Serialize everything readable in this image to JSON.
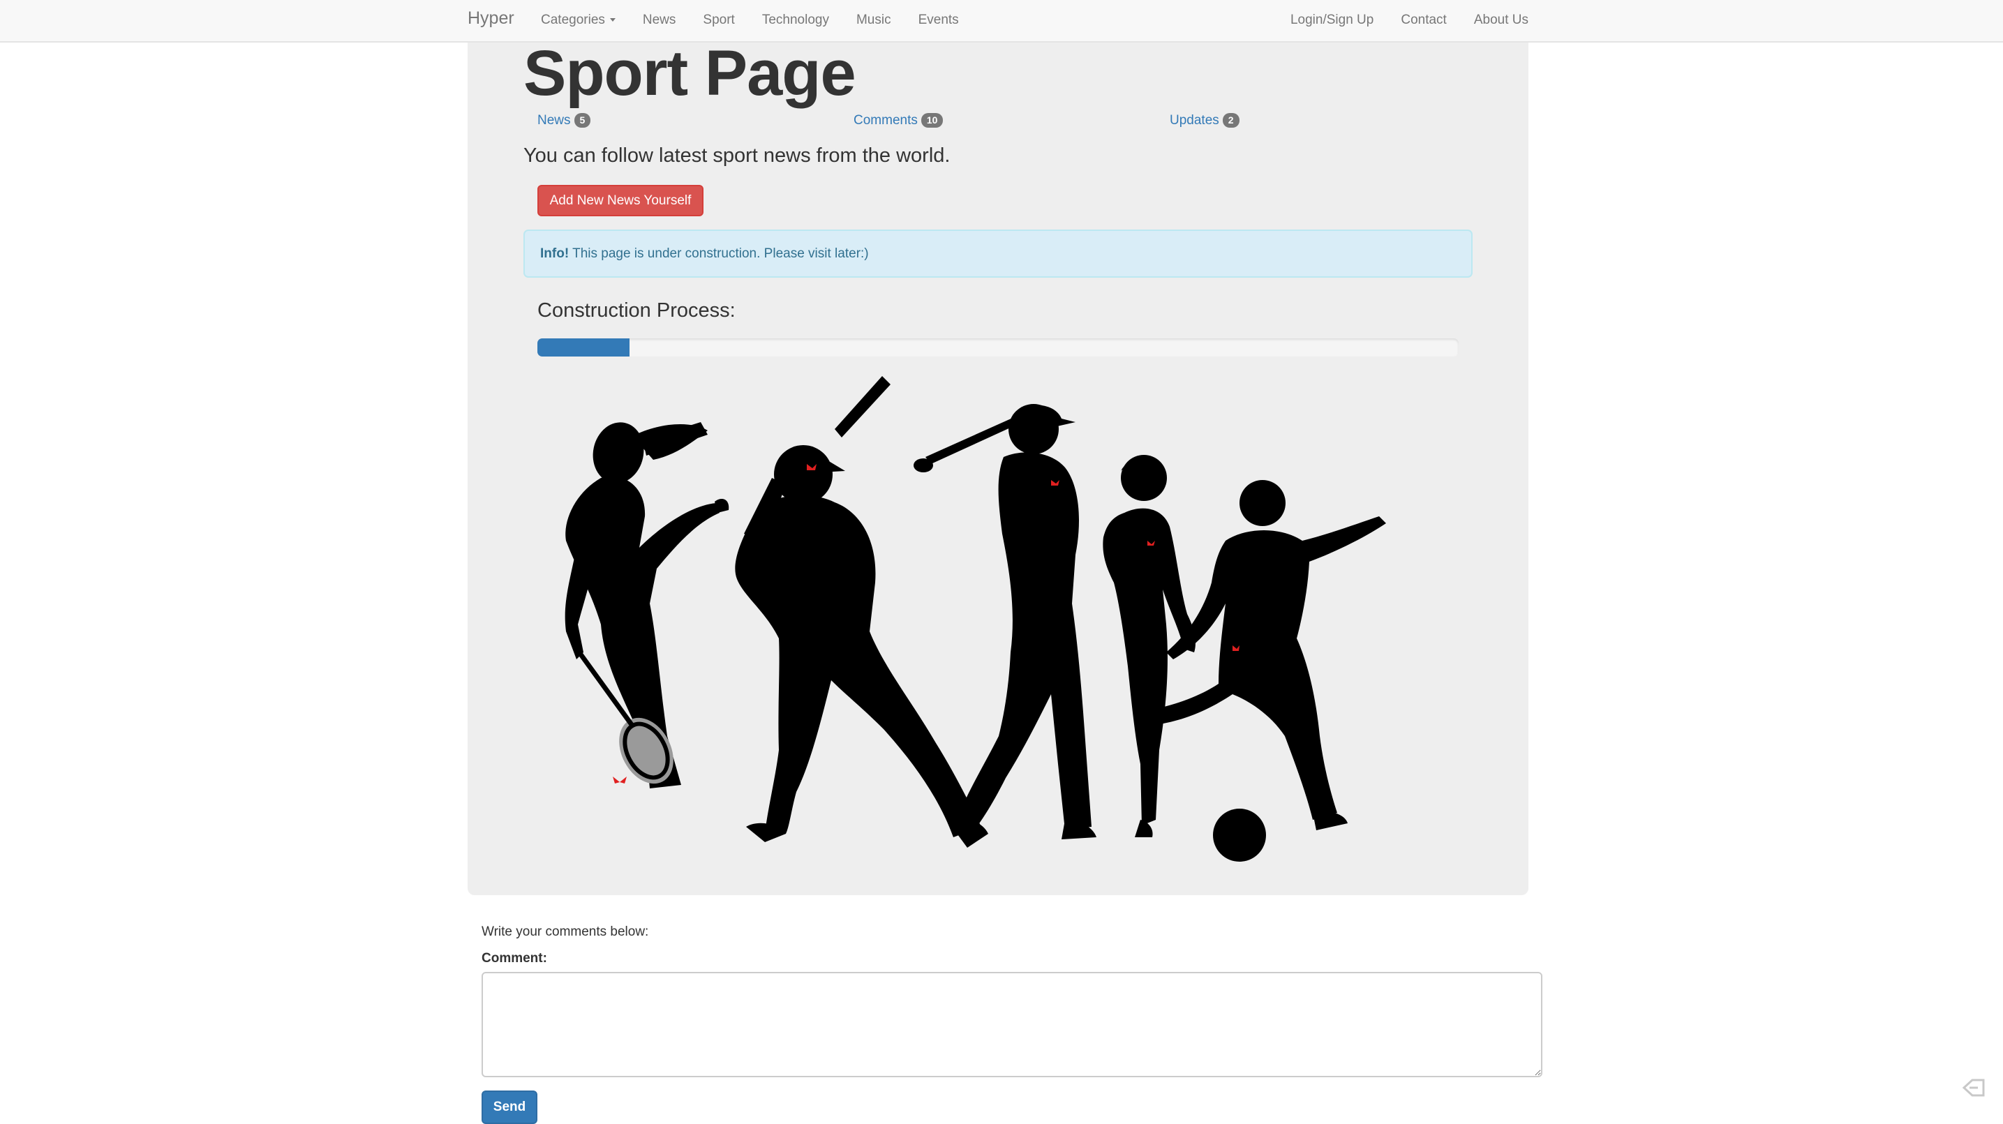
{
  "navbar": {
    "brand": "Hyper",
    "left_items": [
      {
        "label": "Categories",
        "has_dropdown": true
      },
      {
        "label": "News"
      },
      {
        "label": "Sport"
      },
      {
        "label": "Technology"
      },
      {
        "label": "Music"
      },
      {
        "label": "Events"
      }
    ],
    "right_items": [
      {
        "label": "Login/Sign Up"
      },
      {
        "label": "Contact"
      },
      {
        "label": "About Us"
      }
    ]
  },
  "main": {
    "title": "Sport Page",
    "pills": [
      {
        "label": "News",
        "count": "5"
      },
      {
        "label": "Comments",
        "count": "10"
      },
      {
        "label": "Updates",
        "count": "2"
      }
    ],
    "lead": "You can follow latest sport news from the world.",
    "add_button_label": "Add New News Yourself",
    "alert": {
      "strong": "Info!",
      "text": " This page is under construction. Please visit later:)"
    },
    "progress_label": "Construction Process:",
    "progress_percent": 10,
    "illustration": "sports-silhouettes-icon"
  },
  "comments": {
    "hint": "Write your comments below:",
    "label": "Comment:",
    "textarea_value": "",
    "send_label": "Send"
  },
  "colors": {
    "navbar_bg": "#f8f8f8",
    "link": "#337ab7",
    "danger": "#d9534f",
    "info_bg": "#d9edf7",
    "info_text": "#31708f",
    "jumbotron_bg": "#eeeeee",
    "silhouette": "#000000",
    "accent_mark": "#e02020"
  }
}
